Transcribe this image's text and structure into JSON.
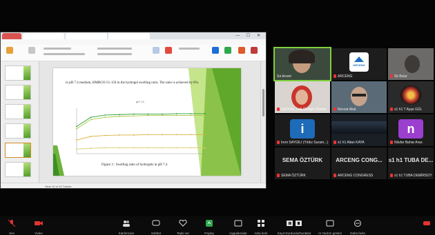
{
  "browser": {
    "tabs": [
      "",
      "",
      "",
      ""
    ],
    "window_controls": "— ☐ ✕"
  },
  "ppt": {
    "slide_text": "in pH 7.4 medium, HMRGO-51-150 in the hydrogel swelling ratio. The ratio is achieved by 8%.",
    "chart_title": "pH 7.4",
    "caption": "Figure 3 : Swelling ratio of hydrogels in pH 7.4",
    "status": "Slide 10 of 19  Turkish"
  },
  "participants": [
    {
      "name": "Sa biravir",
      "muted": false
    },
    {
      "name": "ARCENG",
      "muted": true
    },
    {
      "name": "Sk Bulur",
      "muted": true
    },
    {
      "name": "Gül Kırsı, Lab Gungör Gümür",
      "muted": true
    },
    {
      "name": "Nevzat Akal",
      "muted": true
    },
    {
      "name": "s1 h1 T Ayşe GÜL",
      "muted": true
    },
    {
      "name": "İrem SAYGILI (Yıldız Suram...)",
      "muted": true
    },
    {
      "name": "s1 h1 Altan KAYA",
      "muted": true
    },
    {
      "name": "Nilufar Bahar Aras",
      "muted": true
    },
    {
      "name": "SEMA ÖZTÜRK",
      "label": "SEMA ÖZTÜRK",
      "muted": true
    },
    {
      "name": "ARCENG CONGRESS",
      "label": "ARCENG CONG...",
      "muted": true
    },
    {
      "name": "s1 h1 TUBA DEMİRSOY",
      "label": "s1 h1 TUBA DE...",
      "muted": true
    }
  ],
  "tile_letters": {
    "i": "i",
    "n": "n"
  },
  "arceng_logo": "ARCENG",
  "toolbar": {
    "mute": "Ses",
    "video": "Video",
    "participants": "Katılımcılar",
    "chat": "Sohbet",
    "reactions": "Tepki ver",
    "share": "Paylaş",
    "screen": "Uygulamalar",
    "apps": "Arka kıdır",
    "record": "Kayıt Durdurdu/Duraklat",
    "ai": "AI Yardım gösteri",
    "more": "Daha fazla"
  },
  "colors": {
    "accent_green": "#7fd13b",
    "share_green": "#2fa84f",
    "mute_red": "#e33333",
    "arceng_blue": "#1b6fc2",
    "tile_i_blue": "#1e6bb8",
    "tile_n_purple": "#9b3fcf"
  },
  "chart_data": {
    "type": "line",
    "title": "pH 7.4",
    "series": [
      {
        "values": [
          60,
          80,
          85,
          86,
          87,
          87,
          87,
          88,
          88,
          88
        ]
      },
      {
        "values": [
          55,
          75,
          80,
          82,
          83,
          84,
          84,
          84,
          84,
          84
        ]
      },
      {
        "values": [
          30,
          38,
          40,
          41,
          41,
          42,
          42,
          42,
          42,
          42
        ]
      },
      {
        "values": [
          10,
          12,
          13,
          13,
          13,
          13,
          13,
          13,
          13,
          13
        ]
      }
    ],
    "x": [
      0,
      1,
      2,
      3,
      4,
      5,
      6,
      7,
      8,
      9
    ],
    "ylim": [
      0,
      100
    ],
    "colors": [
      "#2e9e3a",
      "#a7c640",
      "#d7b13a",
      "#d9c96a"
    ]
  }
}
